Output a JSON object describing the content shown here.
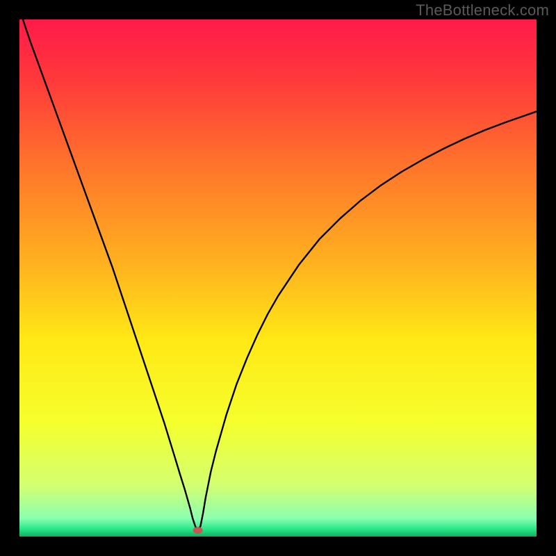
{
  "watermark": "TheBottleneck.com",
  "chart_data": {
    "type": "line",
    "title": "",
    "xlabel": "",
    "ylabel": "",
    "xlim": [
      0,
      100
    ],
    "ylim": [
      0,
      100
    ],
    "background_gradient": [
      {
        "pos": 0.0,
        "color": "#ff1a4a"
      },
      {
        "pos": 0.12,
        "color": "#ff3a3a"
      },
      {
        "pos": 0.3,
        "color": "#ff7a2a"
      },
      {
        "pos": 0.48,
        "color": "#ffb41f"
      },
      {
        "pos": 0.62,
        "color": "#ffe815"
      },
      {
        "pos": 0.78,
        "color": "#f5ff2d"
      },
      {
        "pos": 0.9,
        "color": "#d4ff70"
      },
      {
        "pos": 0.965,
        "color": "#8bffb0"
      },
      {
        "pos": 0.985,
        "color": "#29e98a"
      },
      {
        "pos": 1.0,
        "color": "#0db161"
      }
    ],
    "curve": {
      "x": [
        0,
        2,
        4,
        6,
        8,
        10,
        12,
        14,
        16,
        18,
        20,
        22,
        24,
        26,
        28,
        30,
        31,
        32,
        33,
        33.5,
        34,
        34.3,
        34.5,
        35,
        35.5,
        36,
        37,
        38,
        40,
        42,
        44,
        46,
        48,
        50,
        54,
        58,
        62,
        66,
        70,
        74,
        78,
        82,
        86,
        90,
        94,
        98,
        100
      ],
      "y": [
        102,
        96,
        90.5,
        85,
        79.5,
        74,
        68.5,
        63,
        57.5,
        52,
        46,
        40,
        34,
        28,
        22,
        15.5,
        12.2,
        9,
        5.5,
        3.5,
        2,
        1.4,
        1.2,
        2,
        4.5,
        7.5,
        12.5,
        16.5,
        23.5,
        29.5,
        34.5,
        39,
        43,
        46.5,
        52.5,
        57.5,
        61.5,
        65,
        68,
        70.6,
        72.9,
        75,
        76.9,
        78.6,
        80.1,
        81.5,
        82.2
      ]
    },
    "marker": {
      "x": 34.5,
      "y": 1.2,
      "color": "#c15a52",
      "rx": 7,
      "ry": 5
    },
    "curve_color": "#000000",
    "curve_width": 2.4
  }
}
